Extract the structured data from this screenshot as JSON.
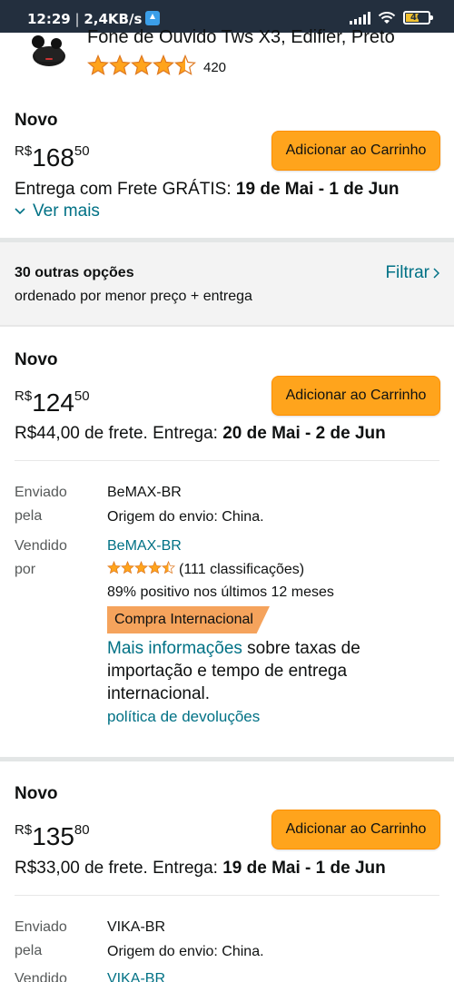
{
  "status_bar": {
    "time": "12:29",
    "speed": "2,4KB/s",
    "battery": "40"
  },
  "product": {
    "title": "Fone de Ouvido Tws X3, Edifier, Preto",
    "rating_count": "420",
    "rating": 4.5
  },
  "main_offer": {
    "condition": "Novo",
    "currency": "R$",
    "price_whole": "168",
    "price_cents": "50",
    "add_to_cart": "Adicionar ao Carrinho",
    "delivery_prefix": "Entrega com Frete GRÁTIS: ",
    "delivery_dates": "19 de Mai - 1 de Jun",
    "see_more": "Ver mais"
  },
  "other_options": {
    "title": "30 outras opções",
    "subtitle": "ordenado por menor preço + entrega",
    "filter": "Filtrar"
  },
  "offers": [
    {
      "condition": "Novo",
      "currency": "R$",
      "price_whole": "124",
      "price_cents": "50",
      "add_to_cart": "Adicionar ao Carrinho",
      "delivery_prefix": "R$44,00 de frete. Entrega: ",
      "delivery_dates": "20 de Mai - 2 de Jun",
      "shipped_label": "Enviado pela",
      "shipped_label_1": "Enviado",
      "shipped_label_2": "pela",
      "shipped_by": "BeMAX-BR",
      "origin": "Origem do envio: China.",
      "sold_label_1": "Vendido",
      "sold_label_2": "por",
      "sold_by": "BeMAX-BR",
      "seller_rating": 4.5,
      "seller_ratings": "(111 classificações)",
      "positive": "89% positivo nos últimos 12 meses",
      "badge": "Compra Internacional",
      "more_info_link": "Mais informações",
      "more_info_text": " sobre taxas de importação e tempo de entrega internacional.",
      "returns": "política de devoluções"
    },
    {
      "condition": "Novo",
      "currency": "R$",
      "price_whole": "135",
      "price_cents": "80",
      "add_to_cart": "Adicionar ao Carrinho",
      "delivery_prefix": "R$33,00 de frete. Entrega: ",
      "delivery_dates": "19 de Mai - 1 de Jun",
      "shipped_label_1": "Enviado",
      "shipped_label_2": "pela",
      "shipped_by": "VIKA-BR",
      "origin": "Origem do envio: China.",
      "sold_label_1": "Vendido",
      "sold_by": "VIKA-BR"
    }
  ],
  "colors": {
    "header_bg": "#232f3e",
    "button": "#ffa41c",
    "link": "#007185",
    "star": "#ffa41c",
    "badge": "#f5a35c"
  }
}
